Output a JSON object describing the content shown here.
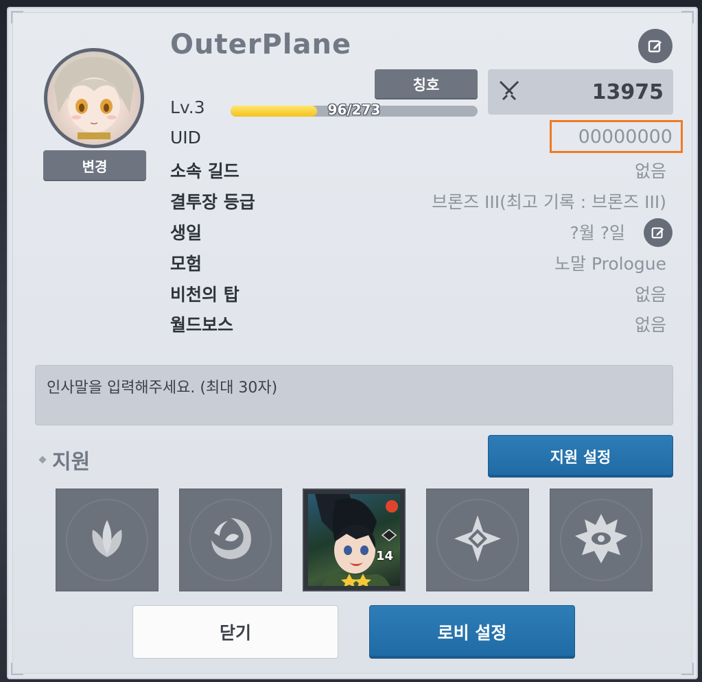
{
  "profile": {
    "name": "OuterPlane",
    "change_label": "변경",
    "title_label": "칭호",
    "combat_power": "13975",
    "level_label": "Lv.3",
    "xp_text": "96/273",
    "xp_progress": 0.35
  },
  "rows": [
    {
      "label": "UID",
      "value": "00000000"
    },
    {
      "label": "소속 길드",
      "value": "없음"
    },
    {
      "label": "결투장 등급",
      "value": "브론즈 III(최고 기록 : 브론즈 III)"
    },
    {
      "label": "생일",
      "value": "?월 ?일"
    },
    {
      "label": "모험",
      "value": "노말 Prologue"
    },
    {
      "label": "비천의 탑",
      "value": "없음"
    },
    {
      "label": "월드보스",
      "value": "없음"
    }
  ],
  "greeting": {
    "placeholder": "인사말을 입력해주세요. (최대 30자)"
  },
  "support": {
    "title": "지원",
    "settings_label": "지원 설정",
    "slots": [
      {
        "icon": "earth-element-icon"
      },
      {
        "icon": "water-element-icon"
      },
      {
        "icon": "hero-portrait",
        "level": "14"
      },
      {
        "icon": "light-element-icon"
      },
      {
        "icon": "dark-element-icon"
      }
    ]
  },
  "footer": {
    "close_label": "닫기",
    "lobby_label": "로비 설정"
  },
  "colors": {
    "accent_blue": "#2177b0",
    "highlight": "#f07a22",
    "xp_fill": "#f3c21e"
  }
}
